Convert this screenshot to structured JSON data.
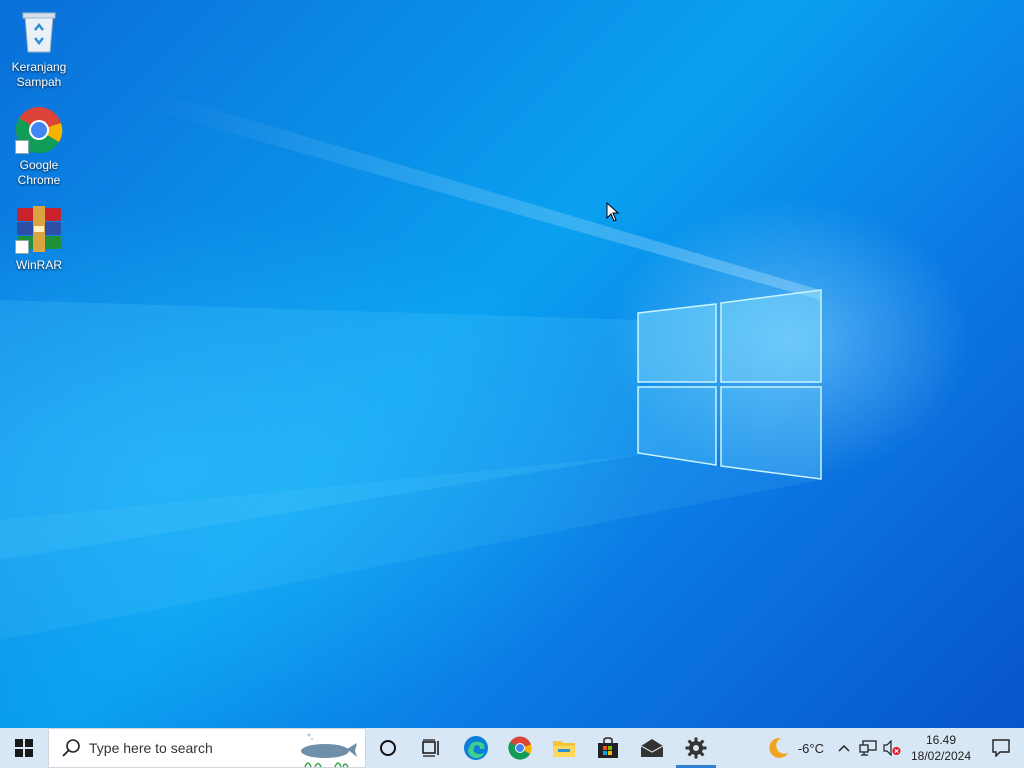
{
  "desktop": {
    "icons": [
      {
        "label": "Keranjang Sampah",
        "icon": "recycle-bin-icon"
      },
      {
        "label": "Google Chrome",
        "icon": "chrome-icon"
      },
      {
        "label": "WinRAR",
        "icon": "winrar-icon"
      }
    ]
  },
  "taskbar": {
    "start_icon": "windows-start-icon",
    "search_placeholder": "Type here to search",
    "apps": [
      {
        "name": "cortana",
        "icon": "cortana-circle-icon"
      },
      {
        "name": "task-view",
        "icon": "task-view-icon"
      },
      {
        "name": "edge",
        "icon": "edge-icon"
      },
      {
        "name": "chrome",
        "icon": "chrome-icon"
      },
      {
        "name": "file-explorer",
        "icon": "folder-icon"
      },
      {
        "name": "store",
        "icon": "store-icon"
      },
      {
        "name": "mail",
        "icon": "mail-icon"
      },
      {
        "name": "settings",
        "icon": "gear-icon",
        "active": true
      }
    ],
    "weather": {
      "icon": "moon-icon",
      "temperature": "-6°C"
    },
    "tray_icons": [
      "chevron-up-icon",
      "network-icon",
      "volume-muted-icon"
    ],
    "clock": {
      "time": "16.49",
      "date": "18/02/2024"
    },
    "notification_icon": "action-center-icon"
  },
  "colors": {
    "accent": "#2f7fd8",
    "taskbar_bg": "#d8e7f5"
  }
}
